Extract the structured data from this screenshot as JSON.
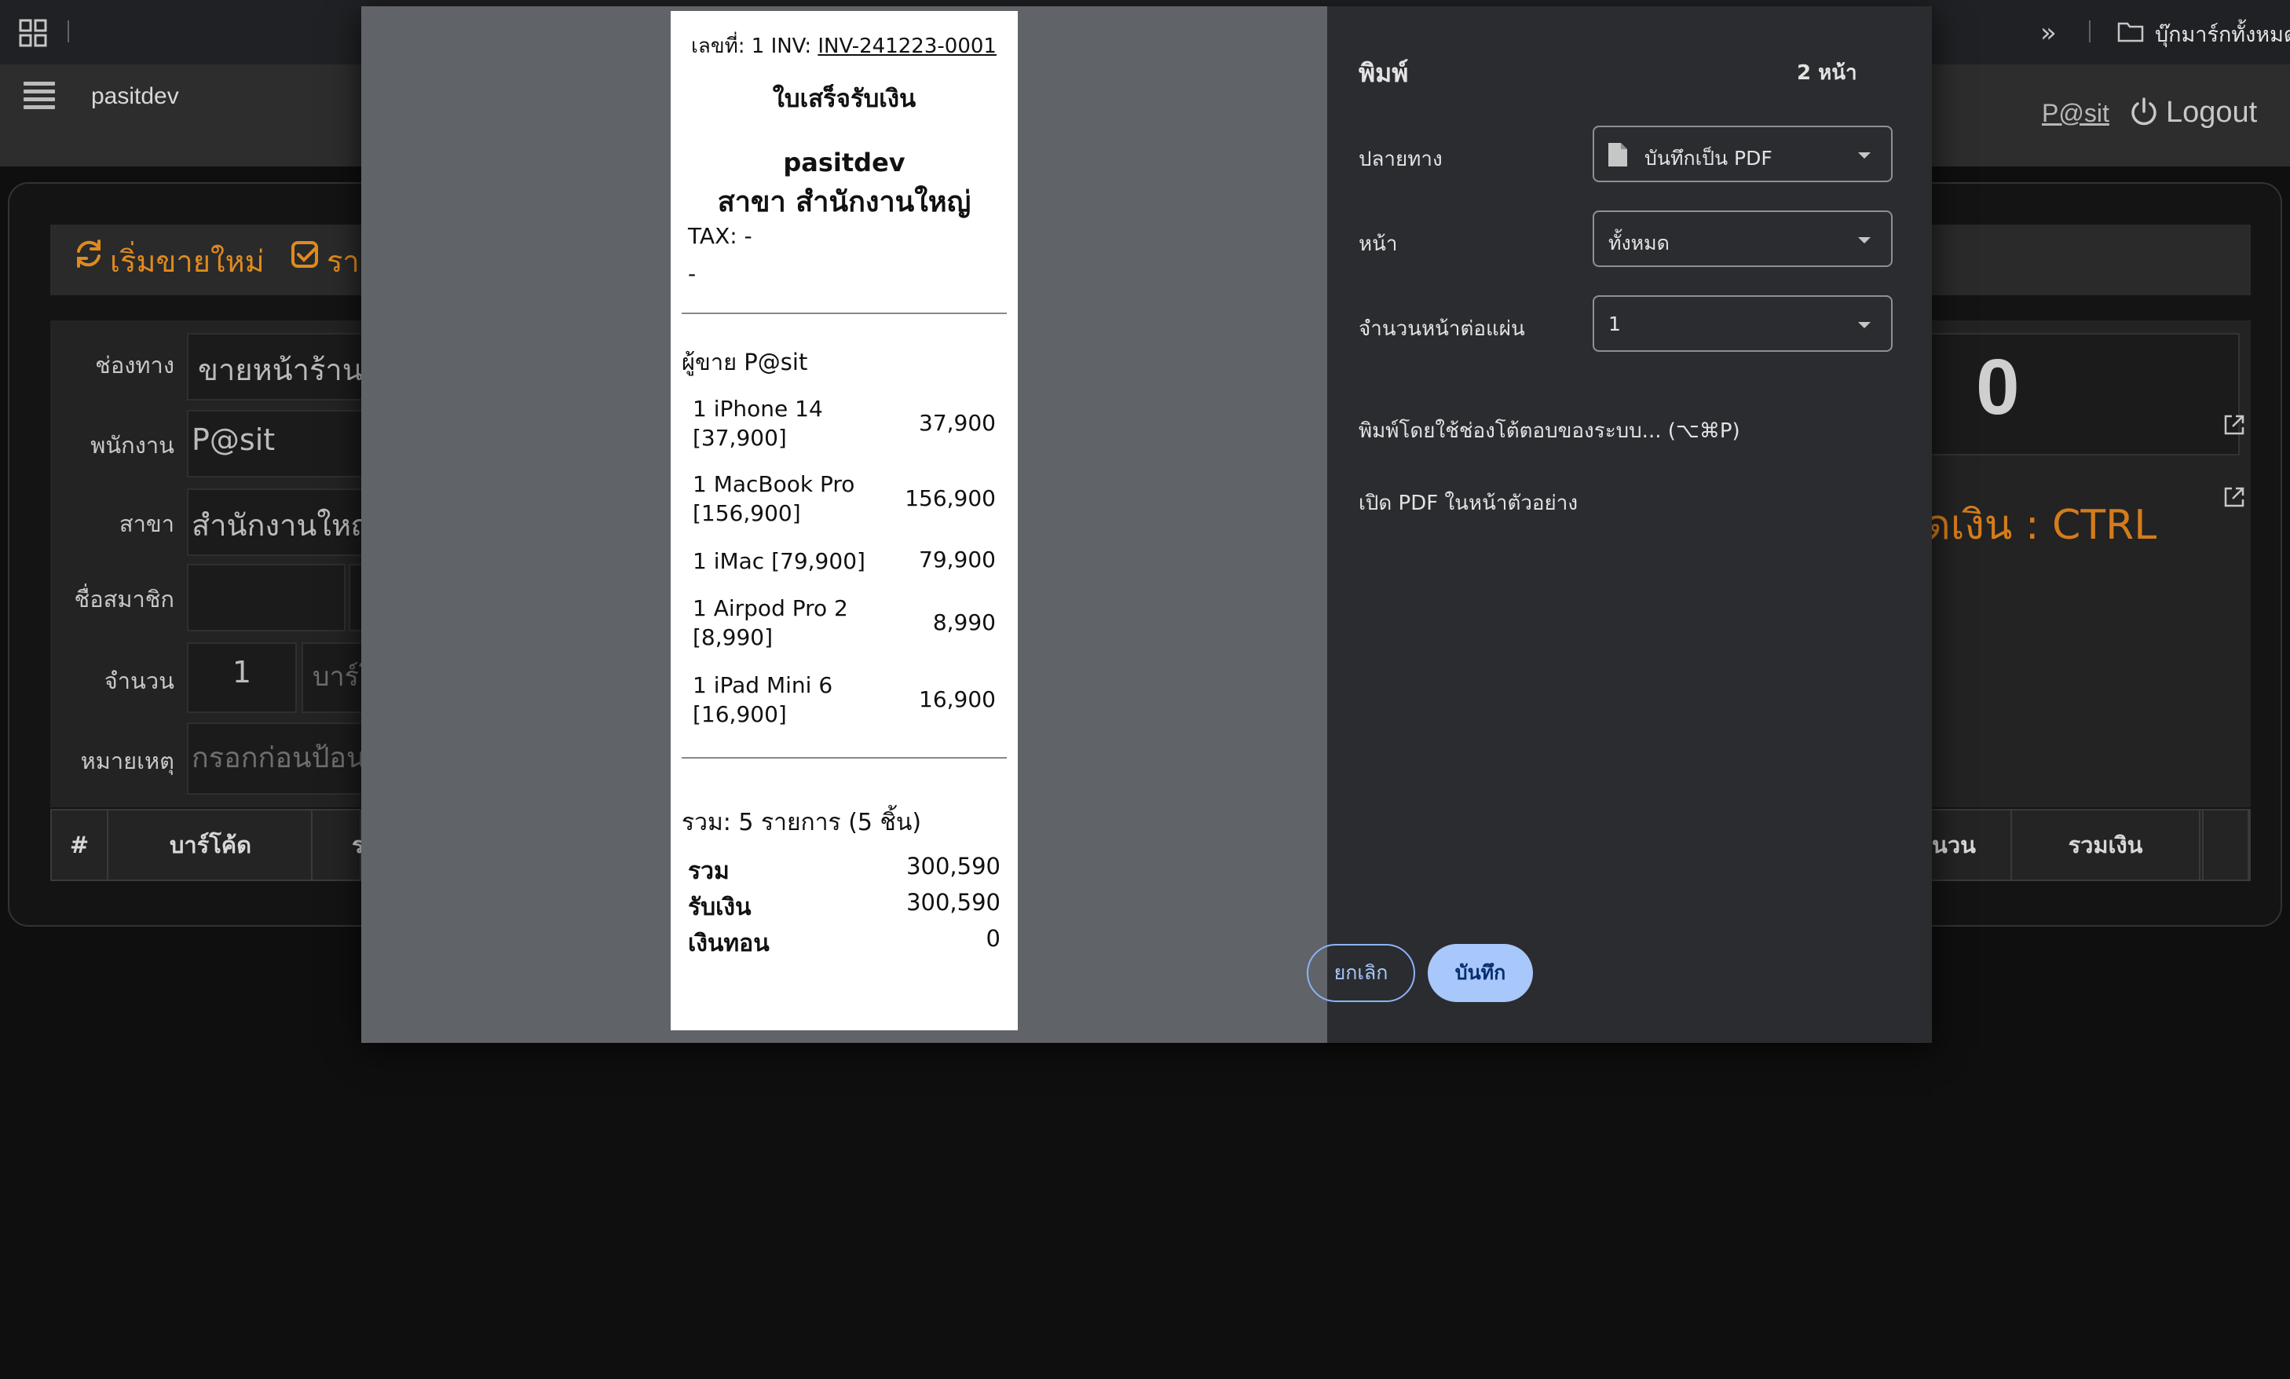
{
  "browser": {
    "bookmarks_label": "บุ๊กมาร์กทั้งหมด",
    "overflow_symbol": "»"
  },
  "app": {
    "brand": "pasitdev",
    "user_link": "P@sit",
    "logout_label": "Logout"
  },
  "pos": {
    "toolbar": {
      "new_sale": "เริ่มขายใหม่",
      "list_tab": "ราย"
    },
    "form": {
      "channel_label": "ช่องทาง",
      "channel_value": "ขายหน้าร้าน",
      "staff_label": "พนักงาน",
      "staff_value": "P@sit",
      "branch_label": "สาขา",
      "branch_value": "สำนักงานใหญ่",
      "member_label": "ชื่อสมาชิก",
      "member_value": "",
      "qty_label": "จำนวน",
      "qty_value": "1",
      "barcode_placeholder": "บาร์โ",
      "note_label": "หมายเหตุ",
      "note_placeholder": "กรอกก่อนป้อน"
    },
    "total_value": "0",
    "shortcut_hint": "ดเงิน : CTRL",
    "table_headers": [
      "#",
      "บาร์โค้ด",
      "ร",
      "นวน",
      "รวมเงิน"
    ]
  },
  "print_dialog": {
    "title": "พิมพ์",
    "page_count": "2 หน้า",
    "destination_label": "ปลายทาง",
    "destination_value": "บันทึกเป็น PDF",
    "pages_label": "หน้า",
    "pages_value": "ทั้งหมด",
    "pages_per_sheet_label": "จำนวนหน้าต่อแผ่น",
    "pages_per_sheet_value": "1",
    "system_dialog_link": "พิมพ์โดยใช้ช่องโต้ตอบของระบบ... (⌥⌘P)",
    "open_pdf_link": "เปิด PDF ในหน้าตัวอย่าง",
    "cancel_label": "ยกเลิก",
    "save_label": "บันทึก"
  },
  "receipt": {
    "number_prefix": "เลขที่: 1 INV: ",
    "invoice_no": "INV-241223-0001",
    "title": "ใบเสร็จรับเงิน",
    "shop_name": "pasitdev",
    "branch": "สาขา สำนักงานใหญ่",
    "tax": "TAX: -",
    "address": "-",
    "seller": "ผู้ขาย P@sit",
    "items": [
      {
        "line1": "1 iPhone 14",
        "line2": "[37,900]",
        "amount": "37,900"
      },
      {
        "line1": "1 MacBook Pro",
        "line2": "[156,900]",
        "amount": "156,900"
      },
      {
        "line1": "1 iMac [79,900]",
        "line2": "",
        "amount": "79,900"
      },
      {
        "line1": "1 Airpod Pro 2",
        "line2": "[8,990]",
        "amount": "8,990"
      },
      {
        "line1": "1 iPad Mini 6",
        "line2": "[16,900]",
        "amount": "16,900"
      }
    ],
    "summary": "รวม: 5 รายการ (5 ชิ้น)",
    "total_label": "รวม",
    "total_value": "300,590",
    "received_label": "รับเงิน",
    "received_value": "300,590",
    "change_label": "เงินทอน",
    "change_value": "0"
  }
}
